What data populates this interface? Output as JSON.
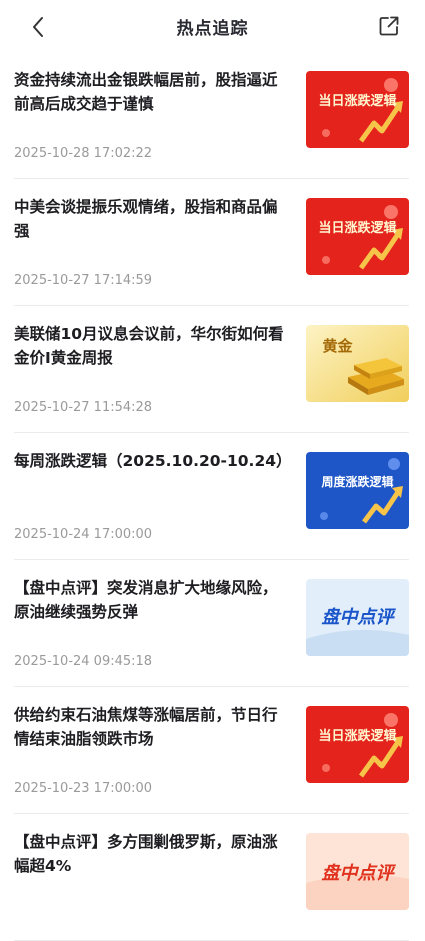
{
  "header": {
    "title": "热点追踪",
    "back_icon": "chevron-left-icon",
    "share_icon": "share-external-icon"
  },
  "colors": {
    "red_thumb": "#e3231c",
    "blue_thumb": "#1e56c8",
    "gold_thumb": "#f5d776"
  },
  "items": [
    {
      "title": "资金持续流出金银跌幅居前，股指逼近前高后成交趋于谨慎",
      "time": "2025-10-28 17:02:22",
      "thumb_style": "red",
      "thumb_label": "当日涨跌逻辑"
    },
    {
      "title": "中美会谈提振乐观情绪，股指和商品偏强",
      "time": "2025-10-27 17:14:59",
      "thumb_style": "red",
      "thumb_label": "当日涨跌逻辑"
    },
    {
      "title": "美联储10月议息会议前，华尔街如何看金价I黄金周报",
      "time": "2025-10-27 11:54:28",
      "thumb_style": "gold",
      "thumb_label": "黄金"
    },
    {
      "title": "每周涨跌逻辑（2025.10.20-10.24）",
      "time": "2025-10-24 17:00:00",
      "thumb_style": "blue",
      "thumb_label": "周度涨跌逻辑"
    },
    {
      "title": "【盘中点评】突发消息扩大地缘风险，原油继续强势反弹",
      "time": "2025-10-24 09:45:18",
      "thumb_style": "light",
      "thumb_label": "盘中点评"
    },
    {
      "title": "供给约束石油焦煤等涨幅居前，节日行情结束油脂领跌市场",
      "time": "2025-10-23 17:00:00",
      "thumb_style": "red",
      "thumb_label": "当日涨跌逻辑"
    },
    {
      "title": "【盘中点评】多方围剿俄罗斯，原油涨幅超4%",
      "time": "",
      "thumb_style": "peach",
      "thumb_label": "盘中点评"
    }
  ]
}
